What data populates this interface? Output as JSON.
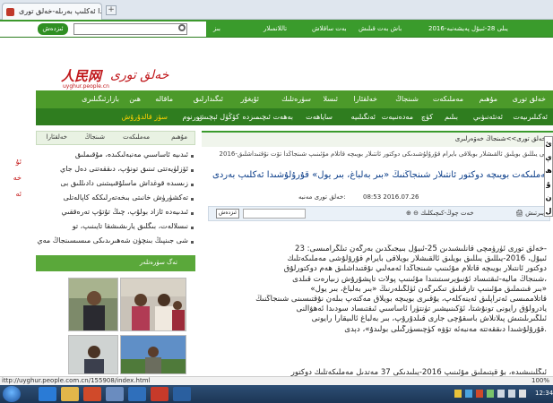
{
  "browser": {
    "tab_title": "قۇرۇلۇشىدا ئەكلىپ بەرىلە-خەلق تورى",
    "new_tab": "+",
    "status_url": "ittp://uyghur.people.com.cn/155908/index.html",
    "zoom": "100%"
  },
  "topbar": {
    "links": [
      "2016-يىلى 28-ئىيۇل پەيشەنبە",
      "باش بەت قىلىش",
      "بەت ساقلاش",
      "تاللانمىلار",
      "بىز"
    ],
    "search_button": "ئىزدەش",
    "search_placeholder": ""
  },
  "site": {
    "logo_text": "人民网",
    "logo_sub": "uyghur.people.cn",
    "logo_uyghur": "خەلق تورى"
  },
  "nav": {
    "row1": [
      "خەلق تورى",
      "مۇھىم",
      "مەملىكەت",
      "شىنجاڭ",
      "خەلقئارا",
      "ئىسلا",
      "سۈرەتلىك",
      "ئۇيغۇر",
      "ئىگىدارلىق",
      "ماقالە",
      "ھىن",
      "بازارئىگىلىرى"
    ],
    "row2": [
      "ئەكىلىرىيەت",
      "ئەنئەنىۋىي",
      "بىلىم",
      "كۈچ",
      "مەدەنىيەت",
      "ئەنگىلىيە",
      "ساياھەت",
      "بەھەت ئىچىمىزدە",
      "كۆڭۈل ئېچىش",
      "تورنوم",
      "سۆز قالدۇرۇش"
    ],
    "row2_highlight": "سۆز قالدۇرۇش"
  },
  "left": {
    "tabs": [
      "مۇھىم",
      "مەملىكەت",
      "شىنجاڭ",
      "خەلقئارا"
    ],
    "items": [
      "ئىدىيە ئاساسىي مەنبەلىكىدە، مۇقىملىق",
      "ئۆزلۈيەتتى تىنىق تونۇپ، دىققەتنى دەل جاي",
      "زىسىدە قوغداش ماسلۇقىيىتىنى دادىللىق بى",
      "تەكشۈرۈش خانىتى بىخەتەرلىككە كاپالەتلى",
      "ئىدىيەدە ئازاد بولۇپ، چىڭ تۇتۇپ تەرەققىي",
      "نىسلالەت، بىگلىق يارىشىشقا تايىنىپ، تو",
      "شى جىنپىڭ بىنچۈن شەھىرىدىكى مىسىسىنجاڭ مەي"
    ],
    "photo_header": "تەگ سۈرەتلەر",
    "red_side": [
      "ئۇ",
      "خە",
      "ئە"
    ]
  },
  "article": {
    "breadcrumb": "خەلق تورى>>شىنجاڭ خەۋەرلىرى",
    "sublead": "2016-يىلى يىللىق بويلىق ئالقىشلار بويلاقى بايرام قۇرۇلۇشىدىكى دوكتور ئانتىلار بويىچە قاتلام مۇئىنىپ شىنجاڭدا تۆت نۇقتىداشلىق",
    "headline": "مەملىكەت بويىچە دوكتور ئانتىلار شىنجاڭنىڭ «بىر بەلباغ، بىر يول» قۇرۇلۇشىدا ئەكلىپ بەردى",
    "date": "08:53 2016.07.26",
    "source_label": "مەنبە:",
    "source": "خەلق تورى",
    "tool_left": "ئىزدەش",
    "tool_mid": "خەت چوڭ-كىچىكلىك",
    "tool_right": "يىرتىش",
    "body_lines": [
      "خەلق تورى ئۈرۈمچى قانلىشىدىن 25-ئىيۇل بىيجىڭدىن بەرگەن تىلگرامىسى: 23-",
      "ئىيۇل، 2016-يىللىق يىللىق بويلىق ئالقىشلار بويلاقى بايرام قۇرۇلۇشى مەملىكەتلىك",
      "دوكتور ئانتىلار بويىچە قاتلام مۇئىنىپ شىنجاڭدا ئەمەلىي نۇقتىداشلىق ھەم دوكتورلۇق",
      "شىنجاڭ ماليە-ئىقتىساد ئۇنىۋېرسىتىتىدا مۇئىنىپ پولات تاپشۇرۇش زىيارەت قىلدى،",
      "«بىر قىتىملىق مۇئىنىپ تارقىلىق تىكىرگەن ئۈلگىلەرنىڭ «بىر بەلباغ، بىر يول»",
      "قاتلاممىسى ئەتراپلىق ئەينەكلەپ، يۇقىرى بويىچە بويلاق مەكتەپ بىلەن نۇقتىسىنى شىنجاڭنىڭ",
      "يادرولۇق رايونى تونۇشتا، ئۆكىنىيشىر تۈنتۈرا ئاساسىي ئىقتىساد سودىدا ئەھۋالنى",
      "ئىلگىرىلىتىش پىلانلاش باسقۇچى جارى قىلدۇرۇپ، بىر بەلباغ ئالىيقارا رايونى",
      "قۇرۇلۇشىدا دىققەتتە مەنبەئە تۆۋە كۈچىسۈرگىلى بولىدۇ»، دېدى."
    ],
    "para2": "ئىگلىنىشىدە، بۇ قېتىملىق مۇئىنىپ 2016-يىلىدىكى 37 مەتدىل مەملىكەتلىك دوكتور"
  },
  "right_float": [
    "ئ",
    "ې",
    "ھ",
    "ۇ",
    "ن",
    "ل"
  ],
  "taskbar": {
    "clock": "12:34"
  }
}
